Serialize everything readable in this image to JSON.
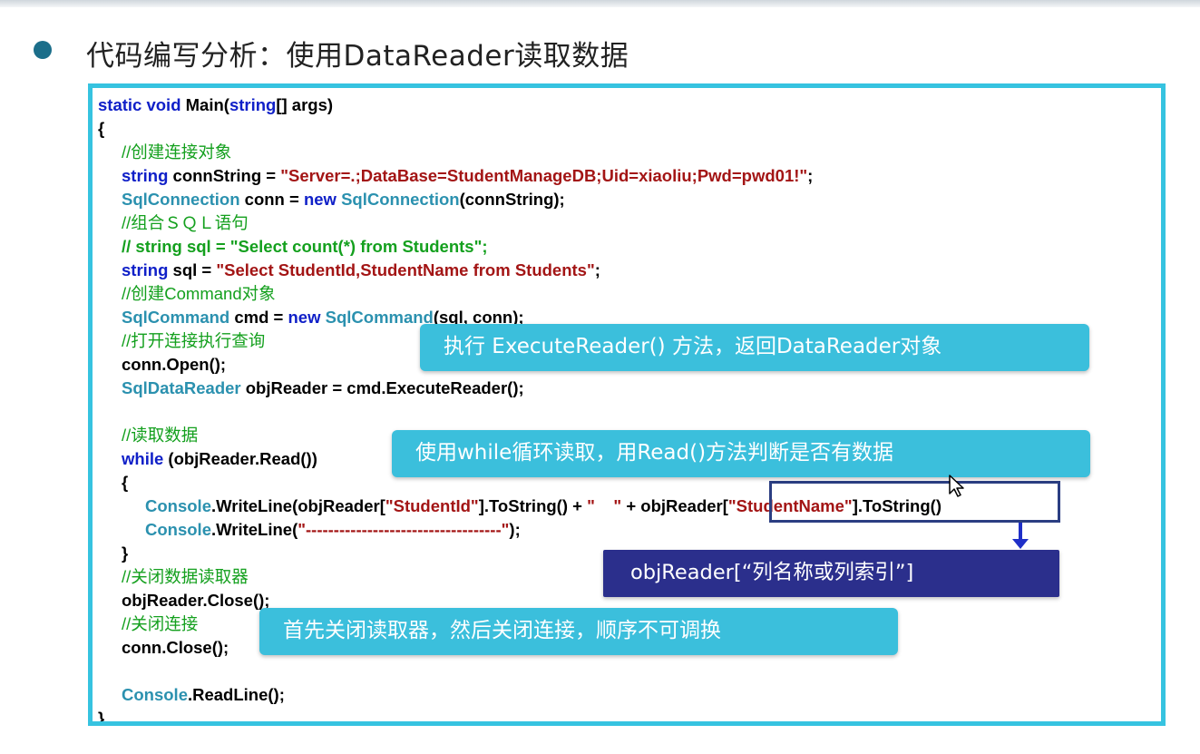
{
  "heading": "代码编写分析：使用DataReader读取数据",
  "code": {
    "l1_a": "static void ",
    "l1_b": "Main(",
    "l1_c": "string",
    "l1_d": "[] args)",
    "l2": "{",
    "c1": "//创建连接对象",
    "l3_a": "string",
    "l3_b": " connString = ",
    "l3_c": "\"Server=.;DataBase=StudentManageDB;Uid=xiaoliu;Pwd=pwd01!\"",
    "l3_d": ";",
    "l4_a": "SqlConnection",
    "l4_b": " conn = ",
    "l4_c": "new ",
    "l4_d": "SqlConnection",
    "l4_e": "(connString);",
    "c2": "//组合ＳＱＬ语句",
    "c3": "// string sql = \"Select count(*) from Students\";",
    "l5_a": "string",
    "l5_b": " sql = ",
    "l5_c": "\"Select StudentId,StudentName from Students\"",
    "l5_d": ";",
    "c4": "//创建Command对象",
    "l6_a": "SqlCommand",
    "l6_b": " cmd = ",
    "l6_c": "new ",
    "l6_d": "SqlCommand",
    "l6_e": "(sql, conn);",
    "c5": "//打开连接执行查询",
    "l7": "conn.Open();",
    "l8_a": "SqlDataReader",
    "l8_b": " objReader = cmd.ExecuteReader();",
    "c6": "//读取数据",
    "l9_a": "while",
    "l9_b": " (objReader.Read())",
    "l10": "{",
    "l11_a": "Console",
    "l11_b": ".WriteLine(objReader[",
    "l11_c": "\"StudentId\"",
    "l11_d": "].ToString() + ",
    "l11_e": "\"    \"",
    "l11_f": " + objReader[",
    "l11_g": "\"StudentName\"",
    "l11_h": "].ToString()",
    "l12_a": "Console",
    "l12_b": ".WriteLine(",
    "l12_c": "\"-----------------------------------\"",
    "l12_d": ");",
    "l13": "}",
    "c7": "//关闭数据读取器",
    "l14": "objReader.Close();",
    "c8": "//关闭连接",
    "l15": "conn.Close();",
    "l16_a": "Console",
    "l16_b": ".ReadLine();",
    "l17": "}"
  },
  "callouts": {
    "execute_reader": "执行 ExecuteReader() 方法，返回DataReader对象",
    "while_loop": "使用while循环读取，用Read()方法判断是否有数据",
    "column_index": "objReader[“列名称或列索引”]",
    "close_order": "首先关闭读取器，然后关闭连接，顺序不可调换"
  }
}
